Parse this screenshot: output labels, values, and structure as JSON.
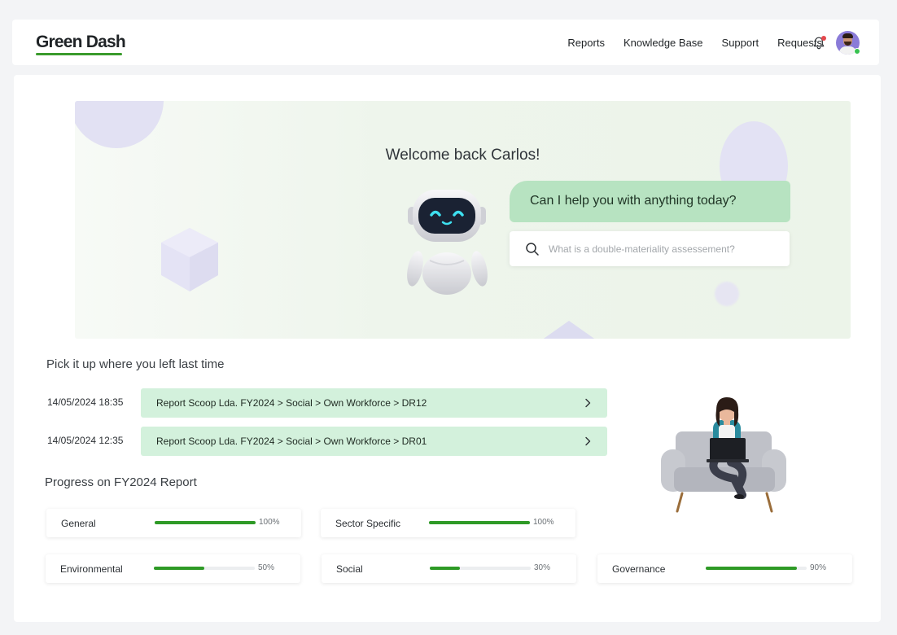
{
  "brand": {
    "logo": "Green Dash",
    "accent": "#3a9b2c"
  },
  "nav": {
    "items": [
      "Reports",
      "Knowledge Base",
      "Support",
      "Requests"
    ]
  },
  "icons": {
    "bell": "bell-icon",
    "search": "search-icon",
    "chevron": "chevron-right-icon"
  },
  "hero": {
    "welcome": "Welcome back Carlos!",
    "bubble": "Can I help you with anything today?",
    "search_placeholder": "What is a double-materiality assessement?"
  },
  "recent": {
    "title": "Pick it up where you left last time",
    "items": [
      {
        "time": "14/05/2024  18:35",
        "path": "Report Scoop Lda. FY2024 > Social > Own Workforce > DR12"
      },
      {
        "time": "14/05/2024  12:35",
        "path": "Report Scoop Lda. FY2024 > Social > Own Workforce > DR01"
      }
    ]
  },
  "progress": {
    "title": "Progress on FY2024 Report",
    "items": [
      {
        "label": "General",
        "value": 100,
        "text": "100%"
      },
      {
        "label": "Sector Specific",
        "value": 100,
        "text": "100%"
      },
      {
        "label": "Environmental",
        "value": 50,
        "text": "50%"
      },
      {
        "label": "Social",
        "value": 30,
        "text": "30%"
      },
      {
        "label": "Governance",
        "value": 90,
        "text": "90%"
      }
    ]
  }
}
